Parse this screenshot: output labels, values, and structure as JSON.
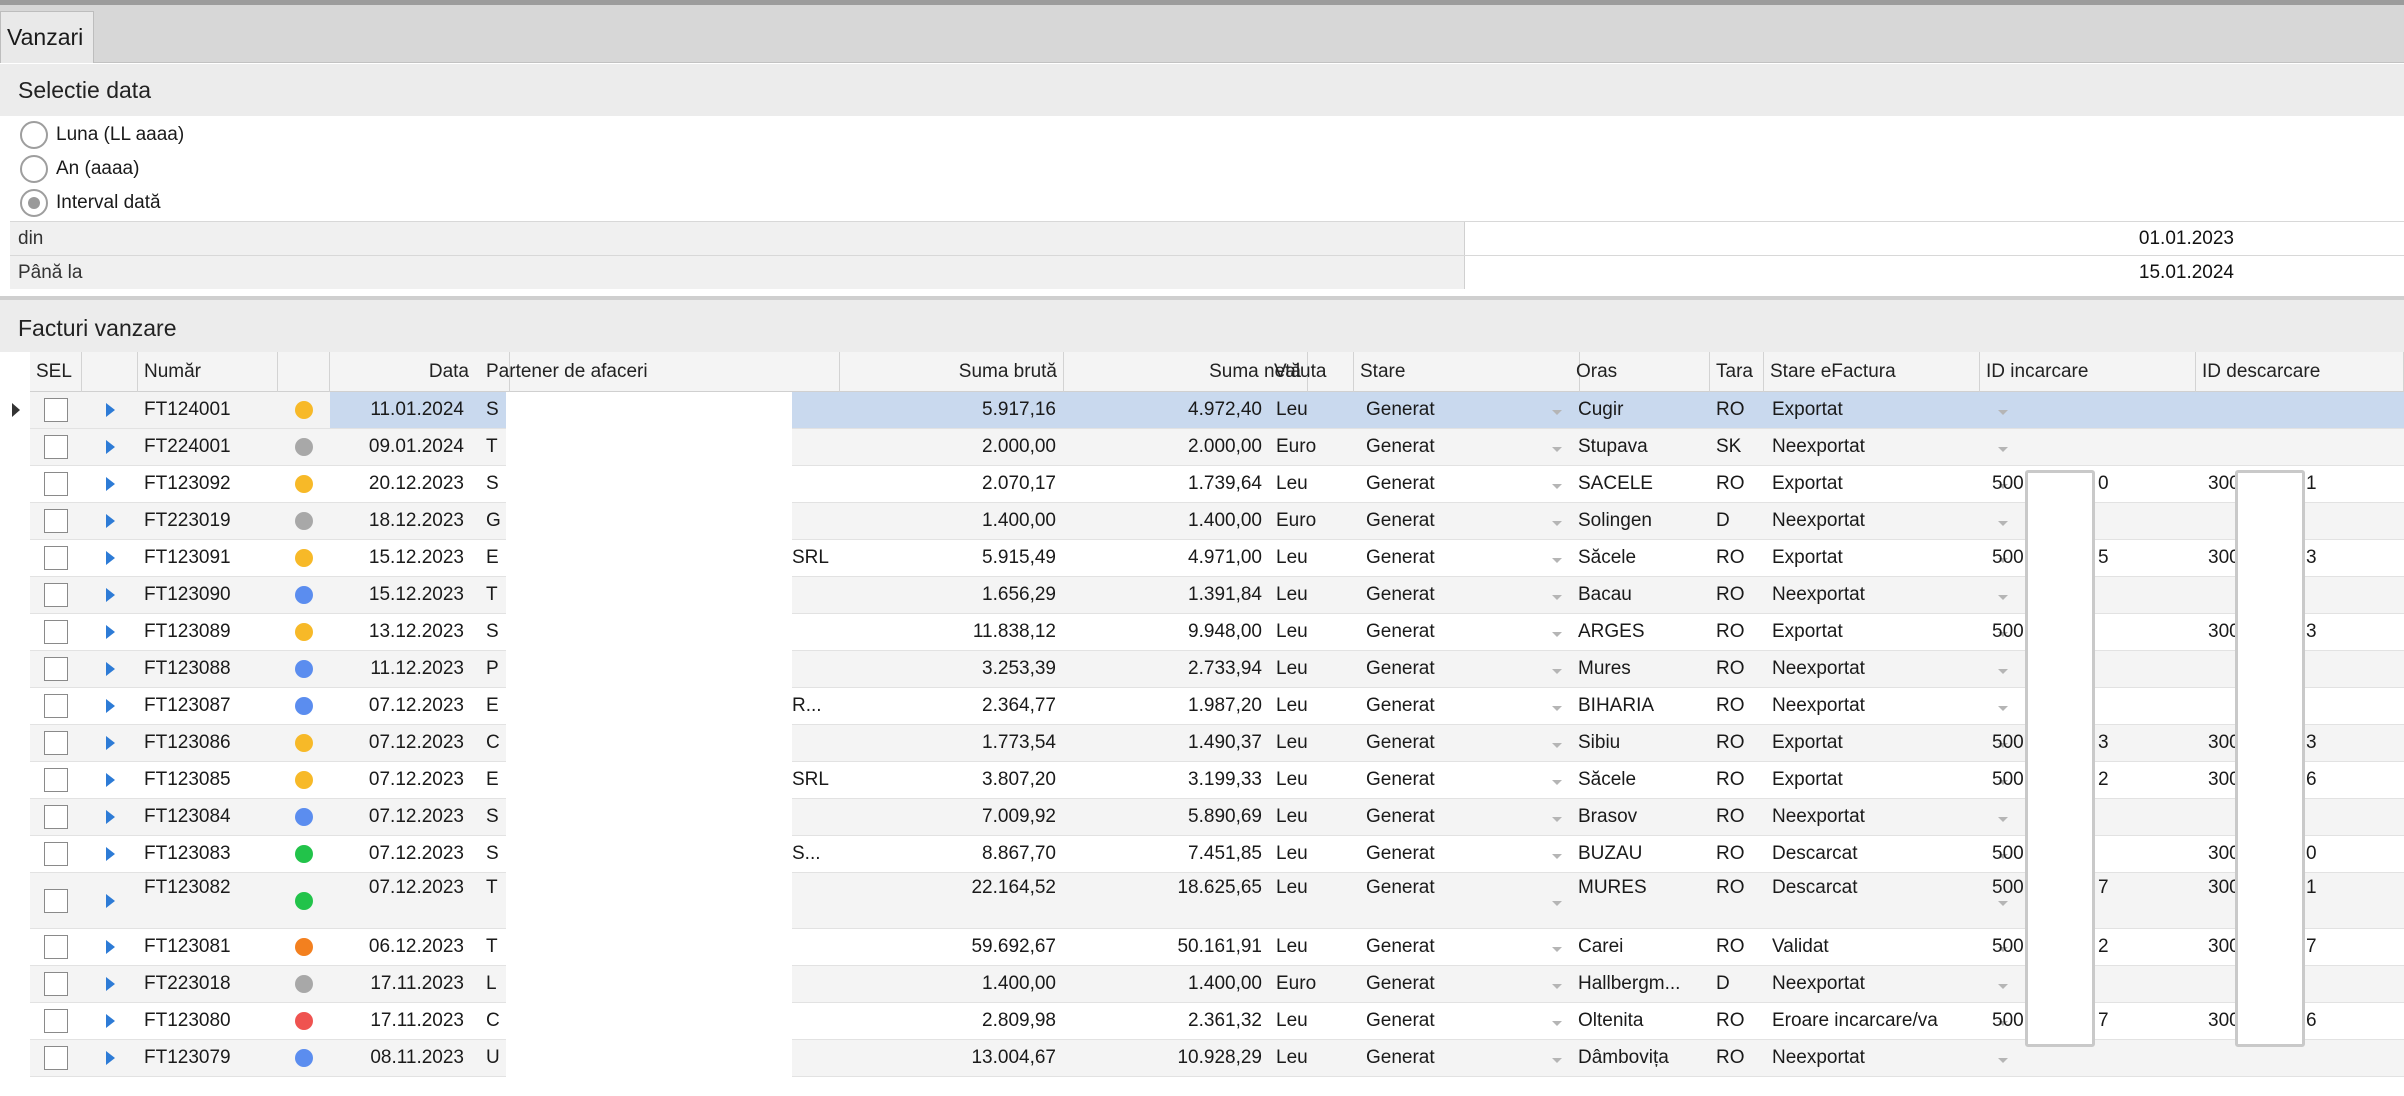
{
  "tab": {
    "label": "Vanzari"
  },
  "date_panel": {
    "title": "Selectie data",
    "options": [
      {
        "label": "Luna (LL aaaa)",
        "checked": false
      },
      {
        "label": "An (aaaa)",
        "checked": false
      },
      {
        "label": "Interval dată",
        "checked": true
      }
    ],
    "from_label": "din",
    "from_value": "01.01.2023",
    "to_label": "Până la",
    "to_value": "15.01.2024"
  },
  "invoices_panel": {
    "title": "Facturi vanzare",
    "columns": {
      "sel": "SEL",
      "numar": "Număr",
      "data": "Data",
      "partener": "Partener de afaceri",
      "bruta": "Suma brută",
      "neta": "Suma netă",
      "valuta": "Valuta",
      "stare": "Stare",
      "oras": "Oras",
      "tara": "Tara",
      "efactura": "Stare eFactura",
      "id_inc": "ID incarcare",
      "id_desc": "ID descarcare"
    },
    "status_colors": {
      "yellow": "#f7b928",
      "gray": "#a8a8a8",
      "blue": "#5b8def",
      "green": "#22c34a",
      "orange": "#f3801f",
      "red": "#ef5350"
    },
    "rows": [
      {
        "numar": "FT124001",
        "status": "yellow",
        "data": "11.01.2024",
        "partener": "S",
        "bruta": "5.917,16",
        "neta": "4.972,40",
        "valuta": "Leu",
        "stare": "Generat",
        "oras": "Cugir",
        "tara": "RO",
        "efactura": "Exportat",
        "id_inc": "",
        "id_desc": ""
      },
      {
        "numar": "FT224001",
        "status": "gray",
        "data": "09.01.2024",
        "partener": "T",
        "bruta": "2.000,00",
        "neta": "2.000,00",
        "valuta": "Euro",
        "stare": "Generat",
        "oras": "Stupava",
        "tara": "SK",
        "efactura": "Neexportat",
        "id_inc": "",
        "id_desc": ""
      },
      {
        "numar": "FT123092",
        "status": "yellow",
        "data": "20.12.2023",
        "partener": "S",
        "bruta": "2.070,17",
        "neta": "1.739,64",
        "valuta": "Leu",
        "stare": "Generat",
        "oras": "SACELE",
        "tara": "RO",
        "efactura": "Exportat",
        "id_inc": "500",
        "id_inc_tail": "0",
        "id_desc": "300",
        "id_desc_tail": "1"
      },
      {
        "numar": "FT223019",
        "status": "gray",
        "data": "18.12.2023",
        "partener": "G",
        "bruta": "1.400,00",
        "neta": "1.400,00",
        "valuta": "Euro",
        "stare": "Generat",
        "oras": "Solingen",
        "tara": "D",
        "efactura": "Neexportat",
        "id_inc": "",
        "id_desc": ""
      },
      {
        "numar": "FT123091",
        "status": "yellow",
        "data": "15.12.2023",
        "partener": "E",
        "partener_tail": "SRL",
        "bruta": "5.915,49",
        "neta": "4.971,00",
        "valuta": "Leu",
        "stare": "Generat",
        "oras": "Săcele",
        "tara": "RO",
        "efactura": "Exportat",
        "id_inc": "500",
        "id_inc_tail": "5",
        "id_desc": "300",
        "id_desc_tail": "3"
      },
      {
        "numar": "FT123090",
        "status": "blue",
        "data": "15.12.2023",
        "partener": "T",
        "bruta": "1.656,29",
        "neta": "1.391,84",
        "valuta": "Leu",
        "stare": "Generat",
        "oras": "Bacau",
        "tara": "RO",
        "efactura": "Neexportat",
        "id_inc": "",
        "id_desc": ""
      },
      {
        "numar": "FT123089",
        "status": "yellow",
        "data": "13.12.2023",
        "partener": "S",
        "bruta": "11.838,12",
        "neta": "9.948,00",
        "valuta": "Leu",
        "stare": "Generat",
        "oras": "ARGES",
        "tara": "RO",
        "efactura": "Exportat",
        "id_inc": "500",
        "id_desc": "300",
        "id_desc_tail": "3"
      },
      {
        "numar": "FT123088",
        "status": "blue",
        "data": "11.12.2023",
        "partener": "P",
        "bruta": "3.253,39",
        "neta": "2.733,94",
        "valuta": "Leu",
        "stare": "Generat",
        "oras": "Mures",
        "tara": "RO",
        "efactura": "Neexportat",
        "id_inc": "",
        "id_desc": ""
      },
      {
        "numar": "FT123087",
        "status": "blue",
        "data": "07.12.2023",
        "partener": "E",
        "partener_tail": "R...",
        "bruta": "2.364,77",
        "neta": "1.987,20",
        "valuta": "Leu",
        "stare": "Generat",
        "oras": "BIHARIA",
        "tara": "RO",
        "efactura": "Neexportat",
        "id_inc": "",
        "id_desc": ""
      },
      {
        "numar": "FT123086",
        "status": "yellow",
        "data": "07.12.2023",
        "partener": "C",
        "bruta": "1.773,54",
        "neta": "1.490,37",
        "valuta": "Leu",
        "stare": "Generat",
        "oras": "Sibiu",
        "tara": "RO",
        "efactura": "Exportat",
        "id_inc": "500",
        "id_inc_tail": "3",
        "id_desc": "300",
        "id_desc_tail": "3"
      },
      {
        "numar": "FT123085",
        "status": "yellow",
        "data": "07.12.2023",
        "partener": "E",
        "partener_tail": "SRL",
        "bruta": "3.807,20",
        "neta": "3.199,33",
        "valuta": "Leu",
        "stare": "Generat",
        "oras": "Săcele",
        "tara": "RO",
        "efactura": "Exportat",
        "id_inc": "500",
        "id_inc_tail": "2",
        "id_desc": "300",
        "id_desc_tail": "6"
      },
      {
        "numar": "FT123084",
        "status": "blue",
        "data": "07.12.2023",
        "partener": "S",
        "bruta": "7.009,92",
        "neta": "5.890,69",
        "valuta": "Leu",
        "stare": "Generat",
        "oras": "Brasov",
        "tara": "RO",
        "efactura": "Neexportat",
        "id_inc": "",
        "id_desc": ""
      },
      {
        "numar": "FT123083",
        "status": "green",
        "data": "07.12.2023",
        "partener": "S",
        "partener_tail": "S...",
        "bruta": "8.867,70",
        "neta": "7.451,85",
        "valuta": "Leu",
        "stare": "Generat",
        "oras": "BUZAU",
        "tara": "RO",
        "efactura": "Descarcat",
        "id_inc": "500",
        "id_desc": "300",
        "id_desc_tail": "0"
      },
      {
        "numar": "FT123082",
        "status": "green",
        "data": "07.12.2023",
        "partener": "T",
        "bruta": "22.164,52",
        "neta": "18.625,65",
        "valuta": "Leu",
        "stare": "Generat",
        "oras": "MURES",
        "tara": "RO",
        "efactura": "Descarcat",
        "id_inc": "500",
        "id_inc_tail": "7",
        "id_desc": "300",
        "id_desc_tail": "1",
        "tall": true
      },
      {
        "numar": "FT123081",
        "status": "orange",
        "data": "06.12.2023",
        "partener": "T",
        "bruta": "59.692,67",
        "neta": "50.161,91",
        "valuta": "Leu",
        "stare": "Generat",
        "oras": "Carei",
        "tara": "RO",
        "efactura": "Validat",
        "id_inc": "500",
        "id_inc_tail": "2",
        "id_desc": "300",
        "id_desc_tail": "7"
      },
      {
        "numar": "FT223018",
        "status": "gray",
        "data": "17.11.2023",
        "partener": "L",
        "bruta": "1.400,00",
        "neta": "1.400,00",
        "valuta": "Euro",
        "stare": "Generat",
        "oras": "Hallbergm...",
        "tara": "D",
        "efactura": "Neexportat",
        "id_inc": "",
        "id_desc": ""
      },
      {
        "numar": "FT123080",
        "status": "red",
        "data": "17.11.2023",
        "partener": "C",
        "bruta": "2.809,98",
        "neta": "2.361,32",
        "valuta": "Leu",
        "stare": "Generat",
        "oras": "Oltenita",
        "tara": "RO",
        "efactura": "Eroare incarcare/va",
        "id_inc": "500",
        "id_inc_tail": "7",
        "id_desc": "300",
        "id_desc_tail": "6"
      },
      {
        "numar": "FT123079",
        "status": "blue",
        "data": "08.11.2023",
        "partener": "U",
        "bruta": "13.004,67",
        "neta": "10.928,29",
        "valuta": "Leu",
        "stare": "Generat",
        "oras": "Dâmbovița",
        "tara": "RO",
        "efactura": "Neexportat",
        "id_inc": "",
        "id_desc": ""
      }
    ]
  }
}
